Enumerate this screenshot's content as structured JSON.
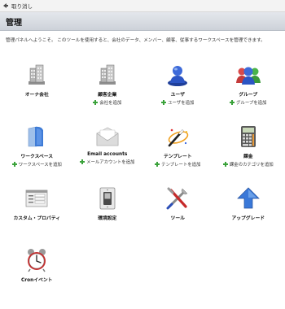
{
  "toolbar": {
    "undo_label": "取り消し"
  },
  "header": {
    "title": "管理"
  },
  "intro": "管理パネルへようこそ。 このツールを使用すると、会社のデータ、メンバー、顧客、従事するワークスペースを管理できます。",
  "tiles": [
    {
      "title": "オーナ会社",
      "add": ""
    },
    {
      "title": "顧客企業",
      "add": "会社を追加"
    },
    {
      "title": "ユーザ",
      "add": "ユーザを追加"
    },
    {
      "title": "グループ",
      "add": "グループを追加"
    },
    {
      "title": "ワークスペース",
      "add": "ワークスペースを追加"
    },
    {
      "title": "Email accounts",
      "add": "メールアカウントを追加"
    },
    {
      "title": "テンプレート",
      "add": "テンプレートを追加"
    },
    {
      "title": "課金",
      "add": "課金のカテゴリを追加"
    },
    {
      "title": "カスタム・プロパティ",
      "add": ""
    },
    {
      "title": "環境設定",
      "add": ""
    },
    {
      "title": "ツール",
      "add": ""
    },
    {
      "title": "アップグレード",
      "add": ""
    },
    {
      "title": "Cronイベント",
      "add": ""
    }
  ],
  "colors": {
    "header_bg": "#cdd2d9",
    "add_icon": "#3aa23a"
  }
}
